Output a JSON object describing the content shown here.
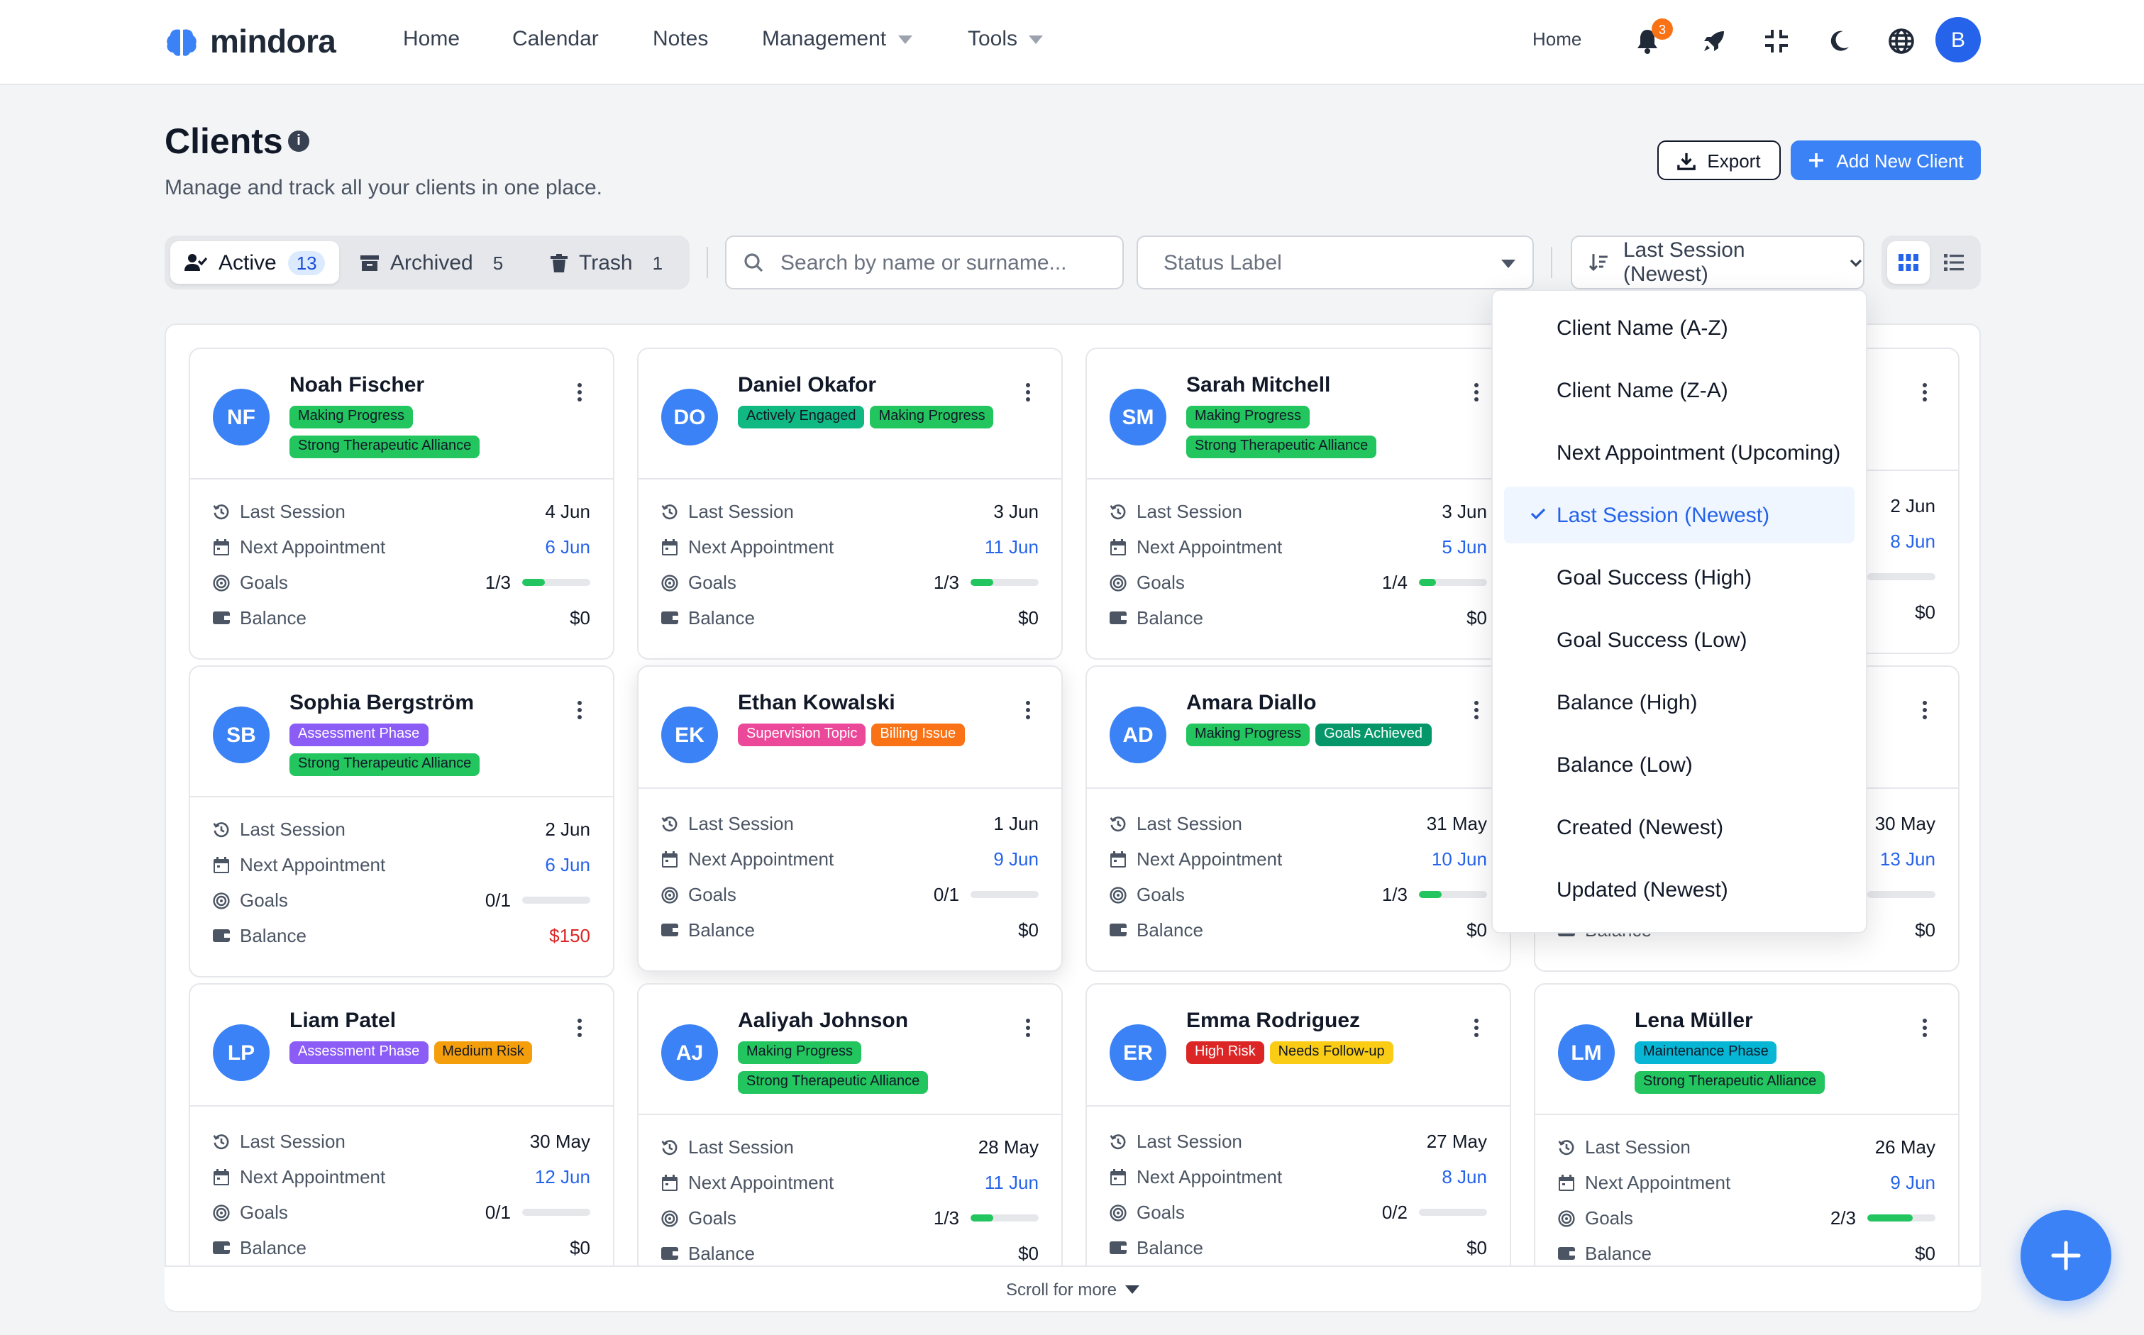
{
  "app": {
    "name": "mindora"
  },
  "nav": {
    "links": [
      "Home",
      "Calendar",
      "Notes",
      "Management",
      "Tools"
    ],
    "right_home": "Home",
    "notif_count": "3",
    "user_initial": "B"
  },
  "header": {
    "title": "Clients",
    "subtitle": "Manage and track all your clients in one place.",
    "export_label": "Export",
    "add_label": "Add New Client"
  },
  "toolbar": {
    "tabs": [
      {
        "label": "Active",
        "count": "13"
      },
      {
        "label": "Archived",
        "count": "5"
      },
      {
        "label": "Trash",
        "count": "1"
      }
    ],
    "search_placeholder": "Search by name or surname...",
    "status_label": "Status Label",
    "sort_label": "Last Session (Newest)"
  },
  "row_labels": {
    "last_session": "Last Session",
    "next_appointment": "Next Appointment",
    "goals": "Goals",
    "balance": "Balance"
  },
  "colors": {
    "accent": "#3b82f6",
    "tag_making_progress": "#22c55e",
    "tag_strong_alliance": "#22c55e",
    "tag_actively_engaged": "#10b981",
    "tag_assessment": "#8b5cf6",
    "tag_supervision": "#ec4899",
    "tag_billing": "#f97316",
    "tag_goals_achieved": "#059669",
    "tag_medium_risk": "#f59e0b",
    "tag_high_risk": "#dc2626",
    "tag_follow_up": "#facc15",
    "tag_maintenance": "#06b6d4"
  },
  "clients": [
    {
      "initials": "NF",
      "name": "Noah Fischer",
      "tags": [
        {
          "text": "Making Progress",
          "color": "#22c55e"
        },
        {
          "text": "Strong Therapeutic Alliance",
          "color": "#22c55e"
        }
      ],
      "last_session": "4 Jun",
      "next_appointment": "6 Jun",
      "goals": "1/3",
      "goal_progress": 0.33,
      "balance": "$0"
    },
    {
      "initials": "DO",
      "name": "Daniel Okafor",
      "tags": [
        {
          "text": "Actively Engaged",
          "color": "#10b981"
        },
        {
          "text": "Making Progress",
          "color": "#22c55e"
        }
      ],
      "last_session": "3 Jun",
      "next_appointment": "11 Jun",
      "goals": "1/3",
      "goal_progress": 0.33,
      "balance": "$0"
    },
    {
      "initials": "SM",
      "name": "Sarah Mitchell",
      "tags": [
        {
          "text": "Making Progress",
          "color": "#22c55e"
        },
        {
          "text": "Strong Therapeutic Alliance",
          "color": "#22c55e"
        }
      ],
      "last_session": "3 Jun",
      "next_appointment": "5 Jun",
      "goals": "1/4",
      "goal_progress": 0.25,
      "balance": "$0"
    },
    {
      "initials": "",
      "name": "",
      "tags": [],
      "last_session": "2 Jun",
      "next_appointment": "8 Jun",
      "goals": "",
      "goal_progress": 0,
      "balance": "$0"
    },
    {
      "initials": "SB",
      "name": "Sophia Bergström",
      "tags": [
        {
          "text": "Assessment Phase",
          "color": "#8b5cf6"
        },
        {
          "text": "Strong Therapeutic Alliance",
          "color": "#22c55e"
        }
      ],
      "last_session": "2 Jun",
      "next_appointment": "6 Jun",
      "goals": "0/1",
      "goal_progress": 0,
      "balance": "$150"
    },
    {
      "initials": "EK",
      "name": "Ethan Kowalski",
      "tags": [
        {
          "text": "Supervision Topic",
          "color": "#ec4899"
        },
        {
          "text": "Billing Issue",
          "color": "#f97316"
        }
      ],
      "last_session": "1 Jun",
      "next_appointment": "9 Jun",
      "goals": "0/1",
      "goal_progress": 0,
      "balance": "$0"
    },
    {
      "initials": "AD",
      "name": "Amara Diallo",
      "tags": [
        {
          "text": "Making Progress",
          "color": "#22c55e"
        },
        {
          "text": "Goals Achieved",
          "color": "#059669"
        }
      ],
      "last_session": "31 May",
      "next_appointment": "10 Jun",
      "goals": "1/3",
      "goal_progress": 0.33,
      "balance": "$0"
    },
    {
      "initials": "",
      "name": "",
      "tags": [],
      "last_session": "30 May",
      "next_appointment": "13 Jun",
      "goals": "",
      "goal_progress": 0,
      "balance": "$0"
    },
    {
      "initials": "LP",
      "name": "Liam Patel",
      "tags": [
        {
          "text": "Assessment Phase",
          "color": "#8b5cf6"
        },
        {
          "text": "Medium Risk",
          "color": "#f59e0b"
        }
      ],
      "last_session": "30 May",
      "next_appointment": "12 Jun",
      "goals": "0/1",
      "goal_progress": 0,
      "balance": "$0"
    },
    {
      "initials": "AJ",
      "name": "Aaliyah Johnson",
      "tags": [
        {
          "text": "Making Progress",
          "color": "#22c55e"
        },
        {
          "text": "Strong Therapeutic Alliance",
          "color": "#22c55e"
        }
      ],
      "last_session": "28 May",
      "next_appointment": "11 Jun",
      "goals": "1/3",
      "goal_progress": 0.33,
      "balance": "$0"
    },
    {
      "initials": "ER",
      "name": "Emma Rodriguez",
      "tags": [
        {
          "text": "High Risk",
          "color": "#dc2626"
        },
        {
          "text": "Needs Follow-up",
          "color": "#facc15"
        }
      ],
      "last_session": "27 May",
      "next_appointment": "8 Jun",
      "goals": "0/2",
      "goal_progress": 0,
      "balance": "$0"
    },
    {
      "initials": "LM",
      "name": "Lena Müller",
      "tags": [
        {
          "text": "Maintenance Phase",
          "color": "#06b6d4"
        },
        {
          "text": "Strong Therapeutic Alliance",
          "color": "#22c55e"
        }
      ],
      "last_session": "26 May",
      "next_appointment": "9 Jun",
      "goals": "2/3",
      "goal_progress": 0.67,
      "balance": "$0"
    }
  ],
  "sort_options": [
    "Client Name (A-Z)",
    "Client Name (Z-A)",
    "Next Appointment (Upcoming)",
    "Last Session (Newest)",
    "Goal Success (High)",
    "Goal Success (Low)",
    "Balance (High)",
    "Balance (Low)",
    "Created (Newest)",
    "Updated (Newest)"
  ],
  "sort_selected": "Last Session (Newest)",
  "scroll_more": "Scroll for more"
}
